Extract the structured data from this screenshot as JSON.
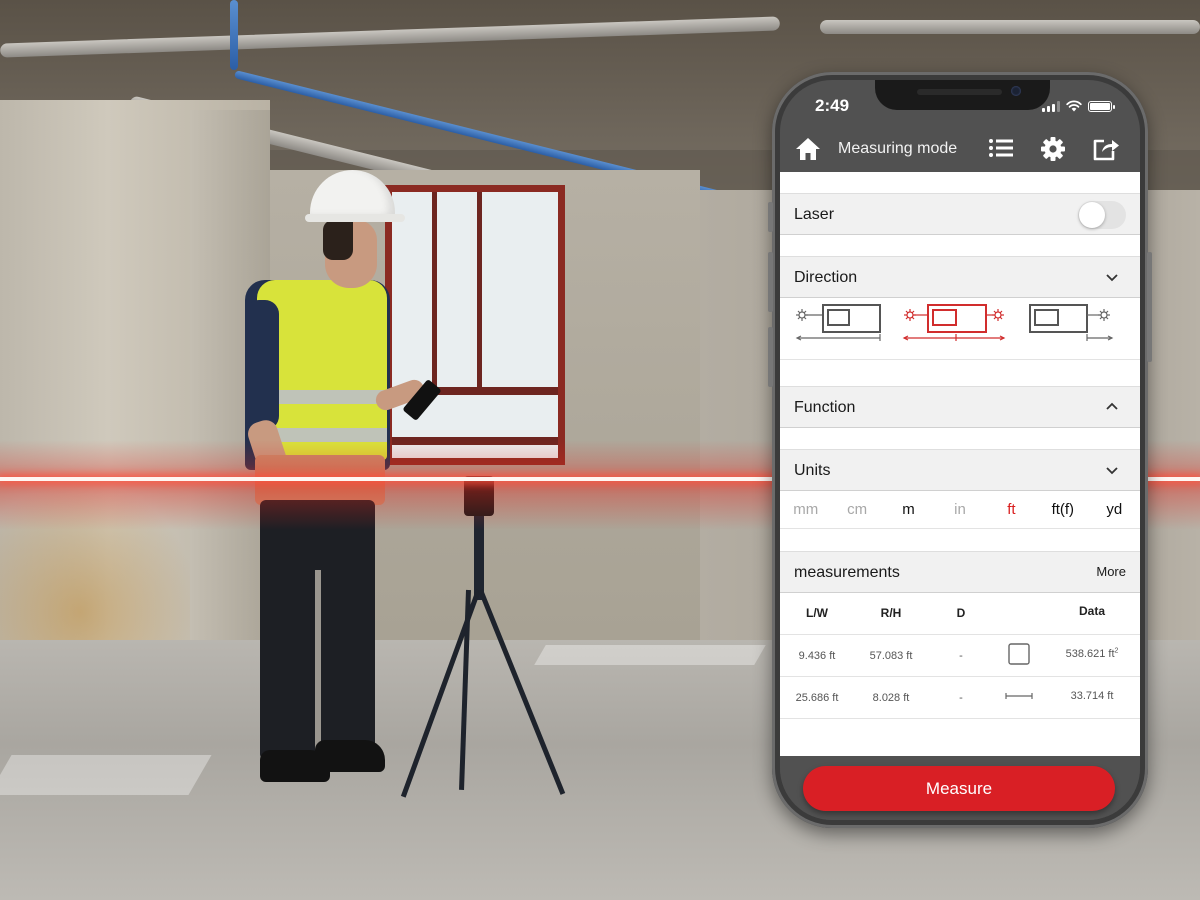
{
  "status_bar": {
    "time": "2:49",
    "icons": [
      "cellular-signal-icon",
      "wifi-icon",
      "battery-icon"
    ]
  },
  "header": {
    "home_icon": "home-icon",
    "title": "Measuring mode",
    "actions": [
      {
        "icon": "list-icon",
        "label": "List"
      },
      {
        "icon": "gear-icon",
        "label": "Settings"
      },
      {
        "icon": "share-icon",
        "label": "Export"
      }
    ]
  },
  "sections": {
    "laser": {
      "label": "Laser",
      "toggle_on": false
    },
    "direction": {
      "label": "Direction",
      "chevron": "chevron-down-icon",
      "options": [
        {
          "name": "rear-reference",
          "selected": false
        },
        {
          "name": "center-both-directions",
          "selected": true
        },
        {
          "name": "front-reference",
          "selected": false
        }
      ]
    },
    "function": {
      "label": "Function",
      "chevron": "chevron-up-icon"
    },
    "units": {
      "label": "Units",
      "chevron": "chevron-down-icon",
      "options": [
        {
          "label": "mm",
          "state": "disabled"
        },
        {
          "label": "cm",
          "state": "disabled"
        },
        {
          "label": "m",
          "state": "normal"
        },
        {
          "label": "in",
          "state": "disabled"
        },
        {
          "label": "ft",
          "state": "active"
        },
        {
          "label": "ft(f)",
          "state": "normal"
        },
        {
          "label": "yd",
          "state": "normal"
        }
      ]
    },
    "measurements": {
      "label": "measurements",
      "more_label": "More",
      "columns": [
        "L/W",
        "R/H",
        "D",
        "",
        "Data"
      ],
      "rows": [
        {
          "lw": "9.436 ft",
          "rh": "57.083 ft",
          "d": "-",
          "type_icon": "area-square-icon",
          "data": "538.621 ft",
          "data_sup": "2"
        },
        {
          "lw": "25.686 ft",
          "rh": "8.028 ft",
          "d": "-",
          "type_icon": "distance-line-icon",
          "data": "33.714 ft",
          "data_sup": ""
        }
      ]
    }
  },
  "measure_button": {
    "label": "Measure"
  },
  "colors": {
    "accent": "#d91f25",
    "active_unit": "#d91e1e",
    "header_bg": "#515151",
    "section_bg": "#f1f1f1"
  }
}
